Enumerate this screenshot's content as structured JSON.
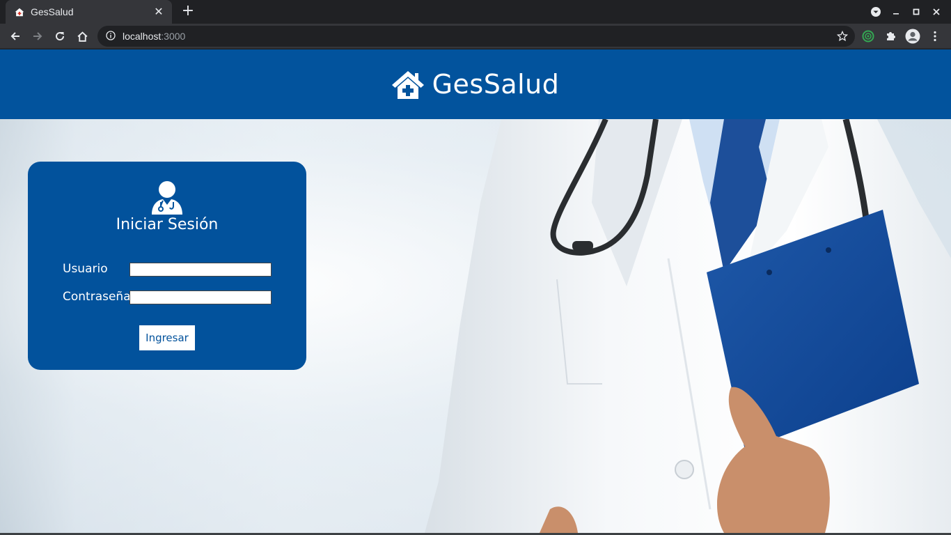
{
  "browser": {
    "tab_title": "GesSalud",
    "url_host": "localhost",
    "url_port": ":3000"
  },
  "header": {
    "brand": "GesSalud"
  },
  "login": {
    "title": "Iniciar Sesión",
    "username_label": "Usuario",
    "username_value": "",
    "password_label": "Contraseña",
    "password_value": "",
    "submit_label": "Ingresar"
  },
  "colors": {
    "brand_blue": "#02539d",
    "chrome_dark": "#202124",
    "chrome_tab": "#35363a"
  },
  "icons": {
    "tab_favicon": "clinic-house-icon",
    "brand_logo": "clinic-house-icon",
    "login_avatar": "doctor-icon"
  }
}
